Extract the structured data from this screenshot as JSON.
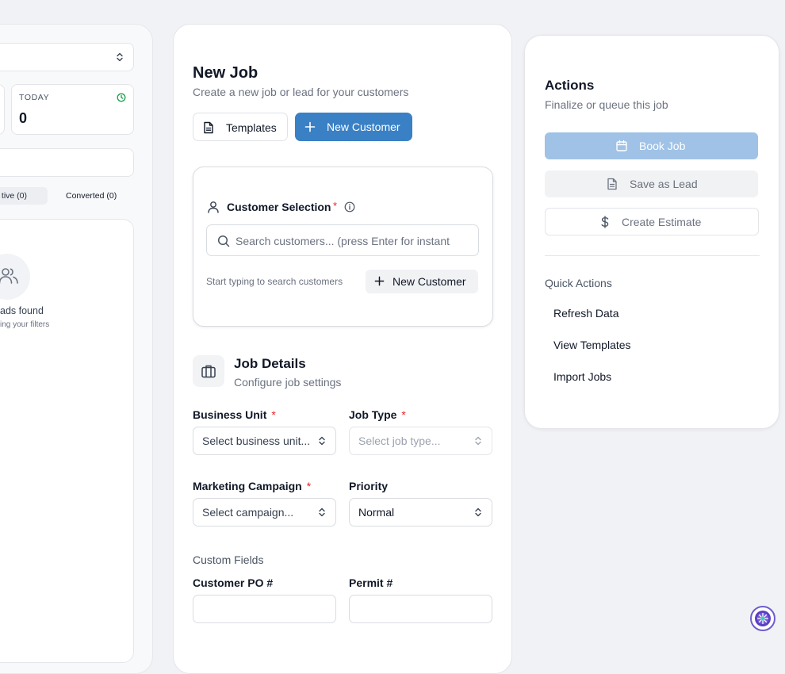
{
  "left_panel": {
    "today_label": "TODAY",
    "today_value": "0",
    "tab_active": "tive (0)",
    "tab_converted": "Converted (0)",
    "empty_title": "ads found",
    "empty_subtitle": "ing your filters"
  },
  "new_job": {
    "title": "New Job",
    "subtitle": "Create a new job or lead for your customers",
    "templates_label": "Templates",
    "new_customer_label": "New Customer"
  },
  "customer_selection": {
    "label": "Customer Selection",
    "required_mark": "*",
    "search_placeholder": "Search customers... (press Enter for instant results)",
    "hint": "Start typing to search customers",
    "new_customer_label": "New Customer"
  },
  "job_details": {
    "title": "Job Details",
    "subtitle": "Configure job settings",
    "fields": {
      "business_unit": {
        "label": "Business Unit",
        "value": "Select business unit..."
      },
      "job_type": {
        "label": "Job Type",
        "value": "Select job type..."
      },
      "marketing_campaign": {
        "label": "Marketing Campaign",
        "value": "Select campaign..."
      },
      "priority": {
        "label": "Priority",
        "value": "Normal"
      }
    },
    "custom_fields_label": "Custom Fields",
    "customer_po_label": "Customer PO #",
    "permit_label": "Permit #"
  },
  "actions": {
    "title": "Actions",
    "subtitle": "Finalize or queue this job",
    "book_job": "Book Job",
    "save_as_lead": "Save as Lead",
    "create_estimate": "Create Estimate",
    "quick_actions_label": "Quick Actions",
    "quick_actions": [
      "Refresh Data",
      "View Templates",
      "Import Jobs"
    ]
  },
  "colors": {
    "primary": "#3a80c4",
    "primary_disabled": "#9fc2e6",
    "required": "#dc2626",
    "clock_green": "#16a34a"
  },
  "icons": {
    "document": "document-icon",
    "plus": "plus-icon",
    "user": "user-icon",
    "info": "info-icon",
    "search": "search-icon",
    "briefcase": "briefcase-icon",
    "calendar": "calendar-icon",
    "dollar": "dollar-icon",
    "chevron": "chevron-updown-icon",
    "clock": "clock-icon",
    "users": "users-icon"
  }
}
